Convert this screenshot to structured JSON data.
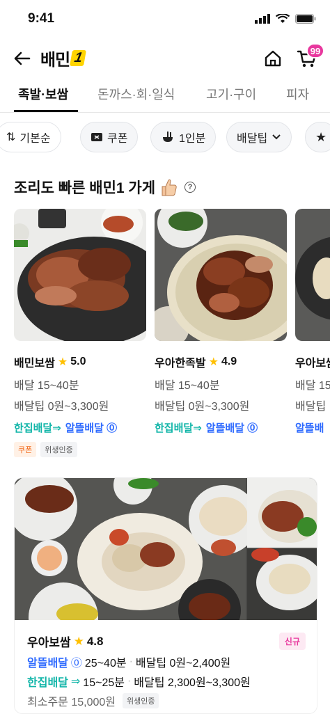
{
  "status": {
    "time": "9:41"
  },
  "header": {
    "brand": "배민",
    "brand_badge": "1",
    "cart_count": "99"
  },
  "tabs": [
    "족발·보쌈",
    "돈까스·회·일식",
    "고기·구이",
    "피자"
  ],
  "filters": [
    {
      "label": "기본순",
      "icon": "sort-icon"
    },
    {
      "label": "쿠폰",
      "icon": "coupon-icon"
    },
    {
      "label": "1인분",
      "icon": "single-serving-icon"
    },
    {
      "label": "배달팁",
      "icon": "chevron-down-icon"
    },
    {
      "label": "",
      "icon": "star-icon"
    }
  ],
  "section": {
    "title": "조리도 빠른 배민1 가게"
  },
  "stores": [
    {
      "name": "배민보쌈",
      "rating": "5.0",
      "delivery_time": "배달 15~40분",
      "delivery_tip": "배달팁 0원~3,300원",
      "badge_hanjip": "한집배달",
      "badge_altteul": "알뜰배달",
      "tags": [
        "쿠폰",
        "위생인증"
      ]
    },
    {
      "name": "우아한족발",
      "rating": "4.9",
      "delivery_time": "배달 15~40분",
      "delivery_tip": "배달팁 0원~3,300원",
      "badge_hanjip": "한집배달",
      "badge_altteul": "알뜰배달",
      "tags": []
    },
    {
      "name": "우아보쌈",
      "rating": "",
      "delivery_time": "배달 15",
      "delivery_tip": "배달팁",
      "badge_hanjip": "",
      "badge_altteul": "알뜰배",
      "tags": []
    }
  ],
  "featured": {
    "name": "우아보쌈",
    "rating": "4.8",
    "badge": "신규",
    "altteul_label": "알뜰배달",
    "altteul_time": "25~40분",
    "altteul_tip": "배달팁 0원~2,400원",
    "hanjip_label": "한집배달",
    "hanjip_time": "15~25분",
    "hanjip_tip": "배달팁 2,300원~3,300원",
    "min_order": "최소주문 15,000원",
    "hygiene": "위생인증"
  },
  "colors": {
    "accent_teal": "#10b5a8",
    "accent_blue": "#2f6bff",
    "badge_pink": "#e8389e",
    "star": "#ffc000"
  }
}
